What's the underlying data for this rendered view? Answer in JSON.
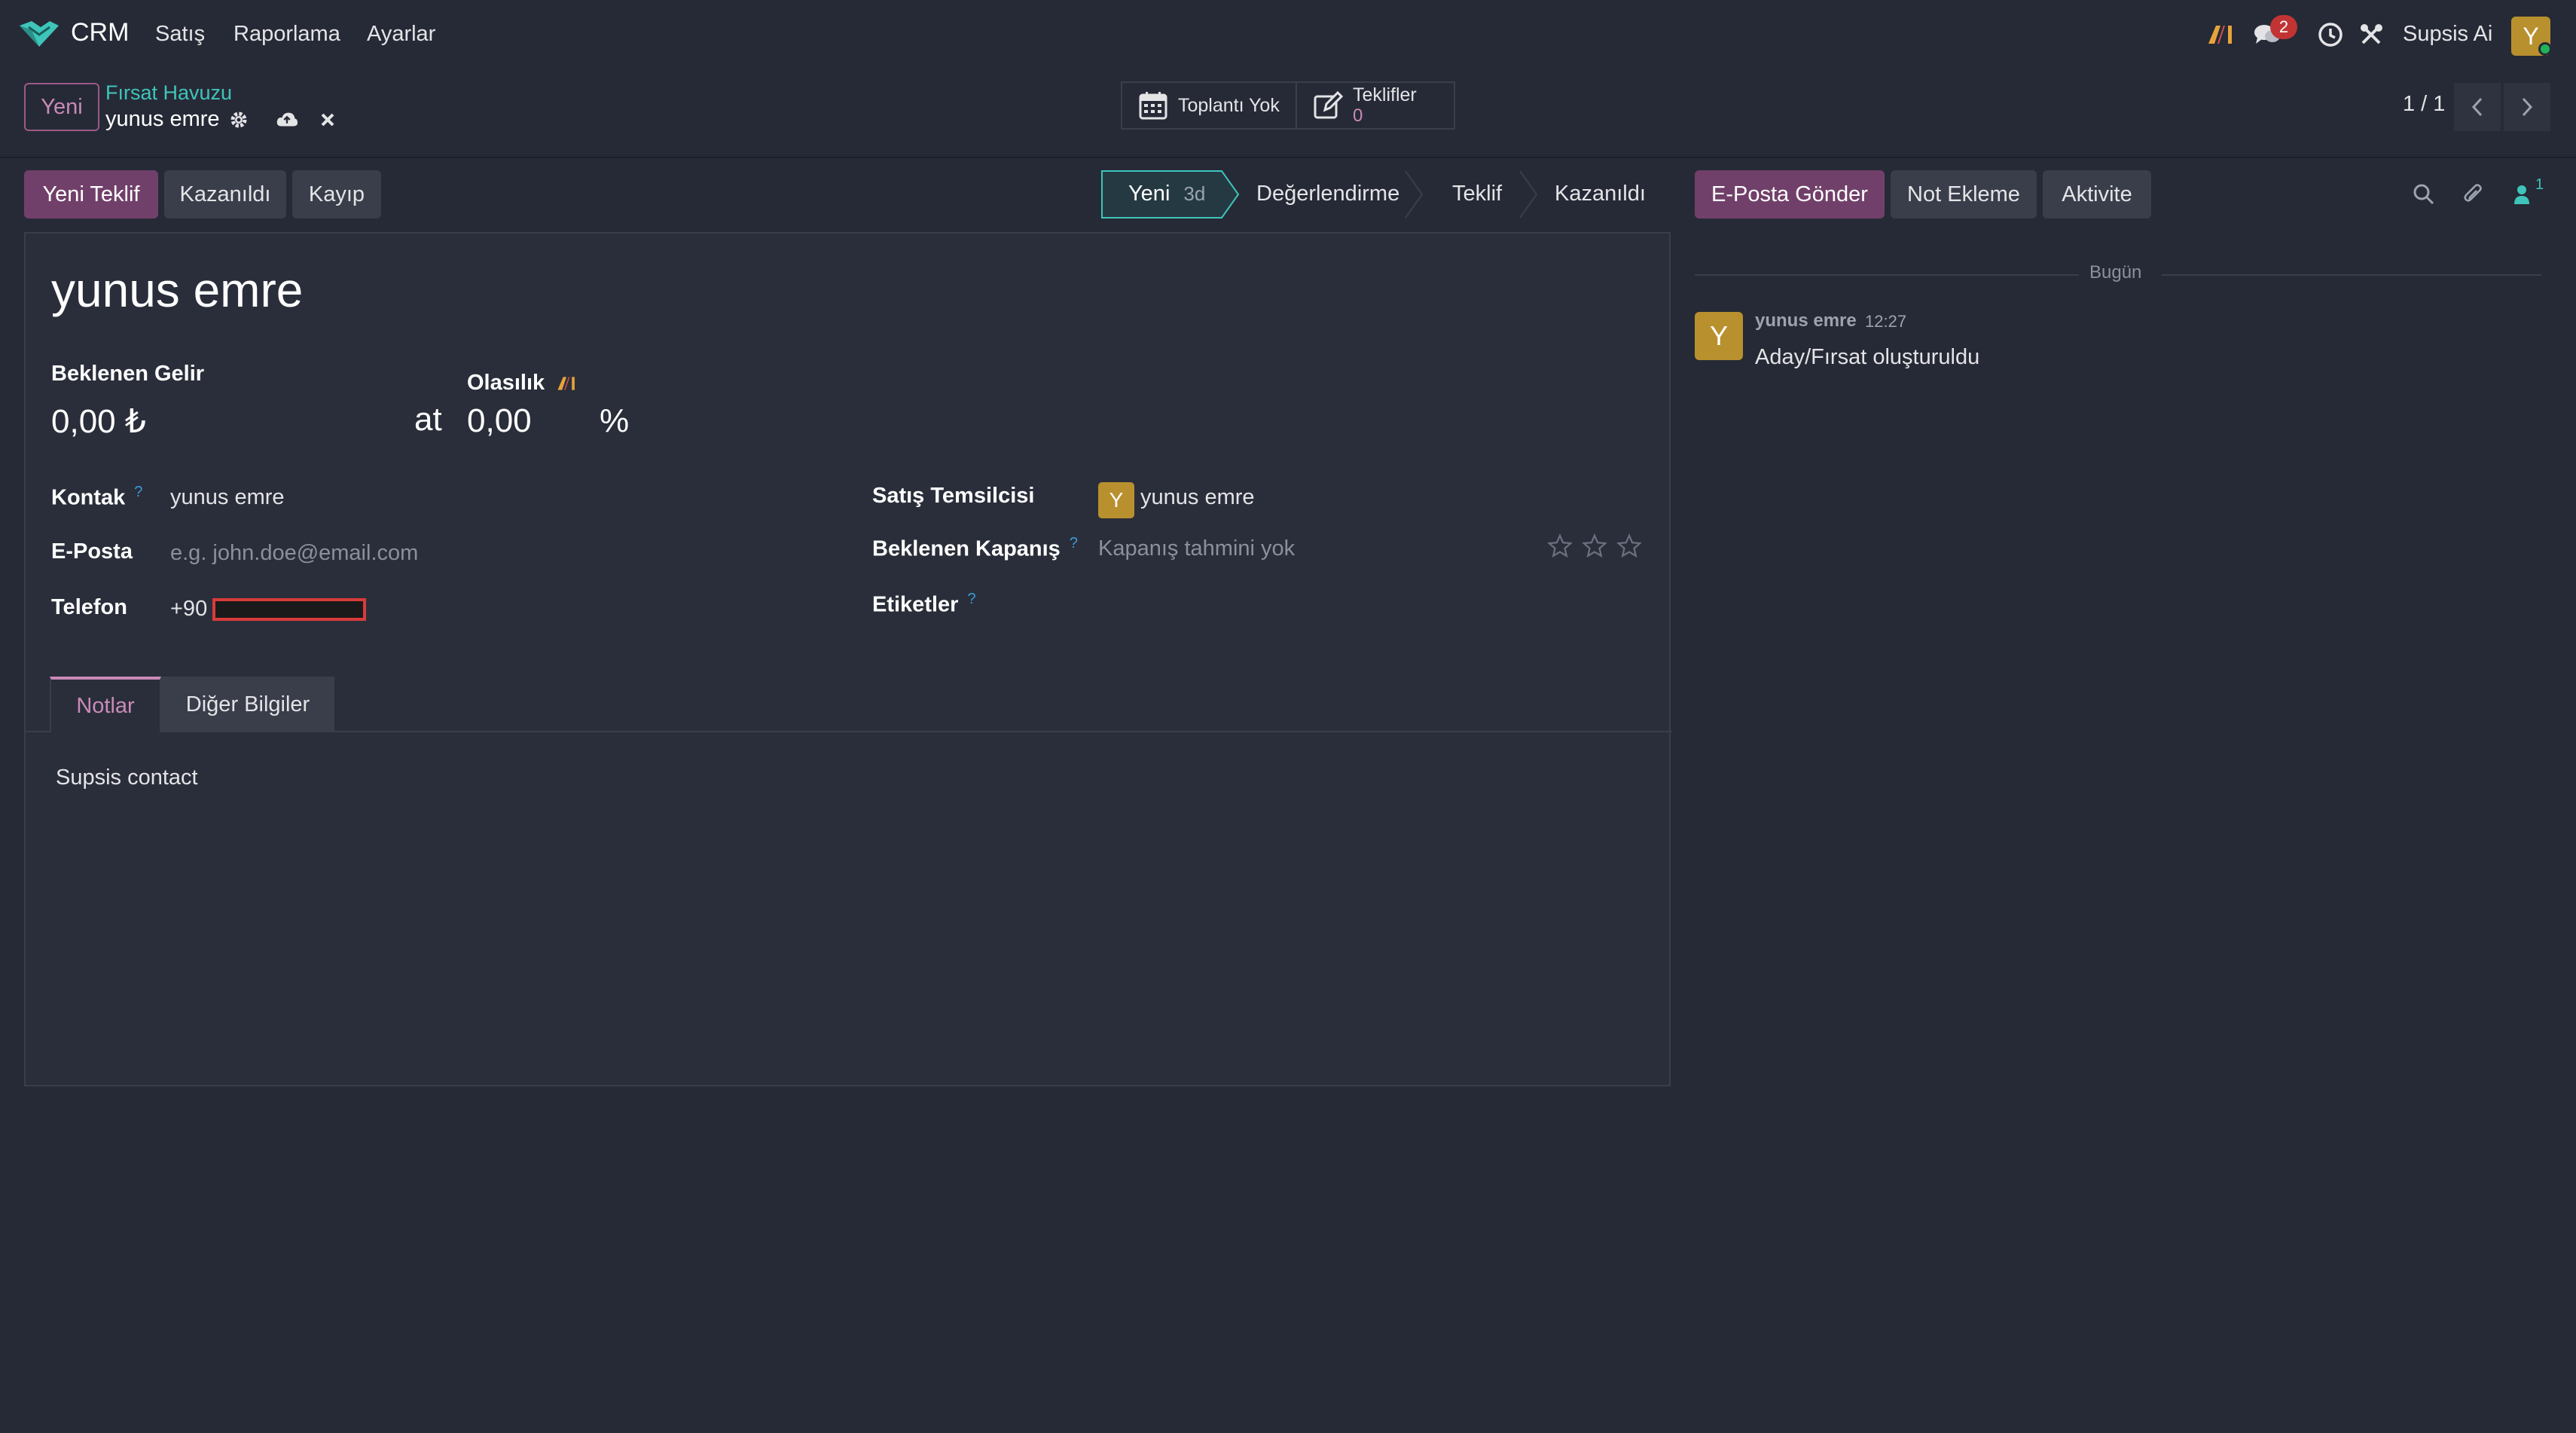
{
  "navbar": {
    "app_name": "CRM",
    "menu": [
      "Satış",
      "Raporlama",
      "Ayarlar"
    ],
    "notification_count": "2",
    "company": "Supsis Ai",
    "user_initial": "Y"
  },
  "breadcrumb": {
    "new_button": "Yeni",
    "parent": "Fırsat Havuzu",
    "current": "yunus emre"
  },
  "smart_buttons": {
    "meeting": "Toplantı Yok",
    "quotes_label": "Teklifler",
    "quotes_count": "0"
  },
  "pager": {
    "text": "1 / 1"
  },
  "actions": {
    "new_quote": "Yeni Teklif",
    "won": "Kazanıldı",
    "lost": "Kayıp"
  },
  "stages": {
    "items": [
      "Yeni",
      "Değerlendirme",
      "Teklif",
      "Kazanıldı"
    ],
    "active_duration": "3d"
  },
  "chatter_actions": {
    "send_email": "E-Posta Gönder",
    "log_note": "Not Ekleme",
    "activity": "Aktivite",
    "follower_count": "1"
  },
  "form": {
    "title": "yunus emre",
    "expected_revenue_label": "Beklenen Gelir",
    "expected_revenue": "0,00 ₺",
    "at": "at",
    "probability_label": "Olasılık",
    "probability": "0,00",
    "percent": "%",
    "contact_label": "Kontak",
    "contact": "yunus emre",
    "email_label": "E-Posta",
    "email_placeholder": "e.g. john.doe@email.com",
    "phone_label": "Telefon",
    "phone_prefix": "+90",
    "salesperson_label": "Satış Temsilcisi",
    "salesperson": "yunus emre",
    "salesperson_initial": "Y",
    "expected_closing_label": "Beklenen Kapanış",
    "expected_closing_placeholder": "Kapanış tahmini yok",
    "tags_label": "Etiketler",
    "qmark": "?"
  },
  "tabs": {
    "notes": "Notlar",
    "other": "Diğer Bilgiler"
  },
  "notes": {
    "content": "Supsis contact"
  },
  "chatter": {
    "today": "Bugün",
    "message_author": "yunus emre",
    "message_time": "12:27",
    "message_body": "Aday/Fırsat oluşturuldu",
    "author_initial": "Y"
  },
  "colors": {
    "background": "#262a36",
    "primary": "#71406a",
    "accent_teal": "#3fc4ba",
    "accent_pink": "#c98ab8",
    "avatar": "#b8902e"
  }
}
